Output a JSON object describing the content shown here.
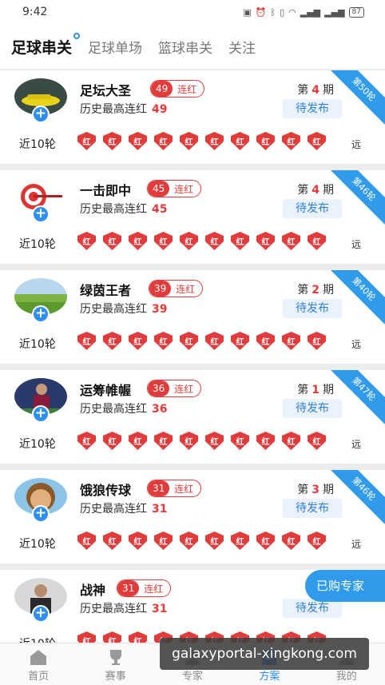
{
  "status_bar": {
    "time": "9:42",
    "battery": "87"
  },
  "tabs": [
    {
      "label": "足球串关",
      "active": true
    },
    {
      "label": "足球单场",
      "active": false
    },
    {
      "label": "篮球串关",
      "active": false
    },
    {
      "label": "关注",
      "active": false
    }
  ],
  "experts": [
    {
      "name": "足坛大圣",
      "streak": "49",
      "streak_label": "连红",
      "history_label": "历史最高连红",
      "history": "49",
      "period_prefix": "第",
      "period": "4",
      "period_suffix": "期",
      "status": "待发布",
      "ribbon": "第50轮",
      "recent_label": "近10轮",
      "far_label": "远",
      "avatar": "car-avatar"
    },
    {
      "name": "一击即中",
      "streak": "45",
      "streak_label": "连红",
      "history_label": "历史最高连红",
      "history": "45",
      "period_prefix": "第",
      "period": "4",
      "period_suffix": "期",
      "status": "待发布",
      "ribbon": "第46轮",
      "recent_label": "近10轮",
      "far_label": "远",
      "avatar": "target-avatar"
    },
    {
      "name": "绿茵王者",
      "streak": "39",
      "streak_label": "连红",
      "history_label": "历史最高连红",
      "history": "39",
      "period_prefix": "第",
      "period": "2",
      "period_suffix": "期",
      "status": "待发布",
      "ribbon": "第40轮",
      "recent_label": "近10轮",
      "far_label": "远",
      "avatar": "field-avatar"
    },
    {
      "name": "运筹帷幄",
      "streak": "36",
      "streak_label": "连红",
      "history_label": "历史最高连红",
      "history": "36",
      "period_prefix": "第",
      "period": "1",
      "period_suffix": "期",
      "status": "待发布",
      "ribbon": "第47轮",
      "recent_label": "近10轮",
      "far_label": "远",
      "avatar": "player-avatar"
    },
    {
      "name": "饿狼传球",
      "streak": "31",
      "streak_label": "连红",
      "history_label": "历史最高连红",
      "history": "31",
      "period_prefix": "第",
      "period": "3",
      "period_suffix": "期",
      "status": "待发布",
      "ribbon": "第46轮",
      "recent_label": "近10轮",
      "far_label": "远",
      "avatar": "face-avatar"
    },
    {
      "name": "战神",
      "streak": "31",
      "streak_label": "连红",
      "history_label": "历史最高连红",
      "history": "31",
      "period_prefix": "第",
      "period": "",
      "period_suffix": "",
      "status": "待发布",
      "ribbon": "",
      "recent_label": "近10轮",
      "far_label": "",
      "avatar": "man-avatar"
    }
  ],
  "recent_mark": "红",
  "floating_button": "已购专家",
  "bottom_nav": [
    {
      "label": "首页",
      "icon": "home-icon",
      "active": false
    },
    {
      "label": "赛事",
      "icon": "trophy-icon",
      "active": false
    },
    {
      "label": "专家",
      "icon": "expert-icon",
      "active": false
    },
    {
      "label": "方案",
      "icon": "plan-icon",
      "active": true
    },
    {
      "label": "我的",
      "icon": "user-icon",
      "active": false
    }
  ],
  "watermark": "galaxyportal-xingkong.com",
  "colors": {
    "accent": "#2f8ff0",
    "red": "#e23b3b",
    "ribbon": "#2f9bea"
  }
}
